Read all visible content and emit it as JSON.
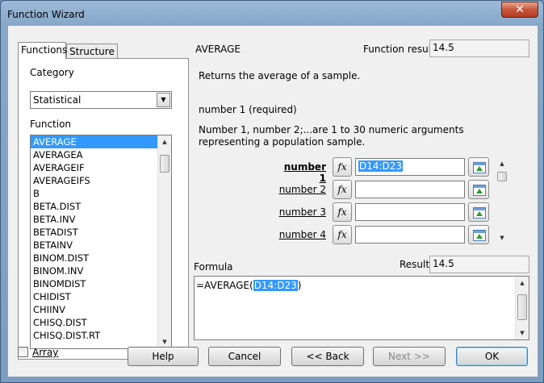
{
  "window": {
    "title": "Function Wizard",
    "close_glyph": "✕"
  },
  "tabs": [
    {
      "label": "Functions",
      "active": true
    },
    {
      "label": "Structure",
      "active": false
    }
  ],
  "category": {
    "label": "Category",
    "value": "Statistical"
  },
  "function_list": {
    "label": "Function",
    "items": [
      "AVERAGE",
      "AVERAGEA",
      "AVERAGEIF",
      "AVERAGEIFS",
      "B",
      "BETA.DIST",
      "BETA.INV",
      "BETADIST",
      "BETAINV",
      "BINOM.DIST",
      "BINOM.INV",
      "BINOMDIST",
      "CHIDIST",
      "CHIINV",
      "CHISQ.DIST",
      "CHISQ.DIST.RT"
    ],
    "selected": "AVERAGE"
  },
  "function_name": "AVERAGE",
  "function_result": {
    "label": "Function result",
    "value": "14.5"
  },
  "description": "Returns the average of a sample.",
  "arg_title": "number 1 (required)",
  "arg_description": "Number 1, number 2;...are 1 to 30 numeric arguments representing a population sample.",
  "arguments": [
    {
      "label": "number 1",
      "value": "D14:D23",
      "bold": true
    },
    {
      "label": "number 2",
      "value": ""
    },
    {
      "label": "number 3",
      "value": ""
    },
    {
      "label": "number 4",
      "value": ""
    }
  ],
  "formula": {
    "label": "Formula",
    "prefix": "=AVERAGE(",
    "highlight": "D14:D23",
    "suffix": ")"
  },
  "result": {
    "label": "Result",
    "value": "14.5"
  },
  "array_checkbox": {
    "label": "Array",
    "checked": false
  },
  "buttons": {
    "help": "Help",
    "cancel": "Cancel",
    "back": "<< Back",
    "next": "Next >>",
    "ok": "OK"
  },
  "icons": {
    "fx": "fx-icon",
    "picker": "shrink-dialog-icon"
  }
}
